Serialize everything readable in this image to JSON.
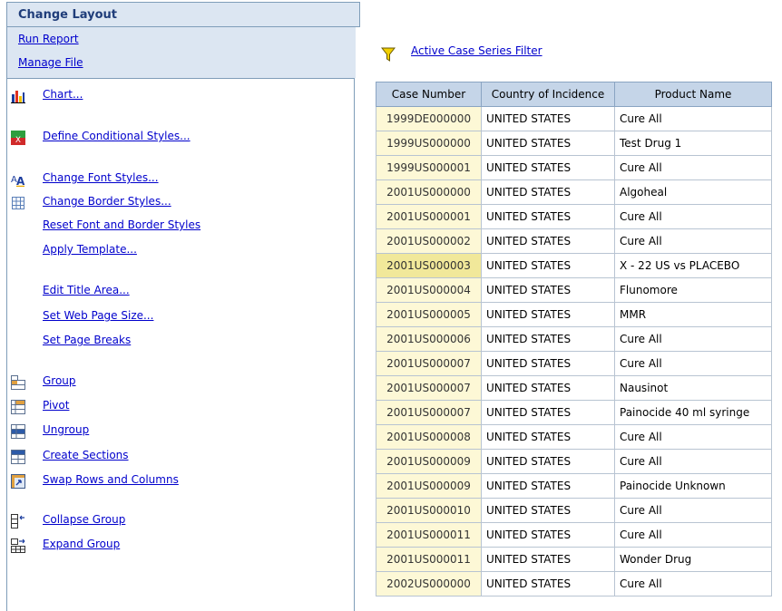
{
  "menu": {
    "header_title": "Change Layout",
    "run_report": "Run Report",
    "manage_file": "Manage File",
    "items": [
      {
        "label": "Chart...",
        "icon": "chart-icon"
      },
      {
        "label": "Define Conditional Styles...",
        "icon": "conditional-styles-icon"
      },
      {
        "label": "Change Font Styles...",
        "icon": "font-styles-icon"
      },
      {
        "label": "Change Border Styles...",
        "icon": "border-styles-icon"
      },
      {
        "label": "Reset Font and Border Styles",
        "icon": ""
      },
      {
        "label": "Apply Template...",
        "icon": ""
      },
      {
        "label": "Edit Title Area...",
        "icon": ""
      },
      {
        "label": "Set Web Page Size...",
        "icon": ""
      },
      {
        "label": "Set Page Breaks",
        "icon": ""
      },
      {
        "label": "Group",
        "icon": "group-icon"
      },
      {
        "label": "Pivot",
        "icon": "pivot-icon"
      },
      {
        "label": "Ungroup",
        "icon": "ungroup-icon"
      },
      {
        "label": "Create Sections",
        "icon": "sections-icon"
      },
      {
        "label": "Swap Rows and Columns",
        "icon": "swap-icon"
      },
      {
        "label": "Collapse Group",
        "icon": "collapse-icon"
      },
      {
        "label": "Expand Group",
        "icon": "expand-icon"
      }
    ]
  },
  "filter": {
    "label": "Active Case Series Filter",
    "icon": "filter-funnel-icon"
  },
  "table": {
    "headers": [
      "Case Number",
      "Country of Incidence",
      "Product Name"
    ],
    "rows": [
      [
        "1999DE000000",
        "UNITED STATES",
        "Cure All"
      ],
      [
        "1999US000000",
        "UNITED STATES",
        "Test Drug 1"
      ],
      [
        "1999US000001",
        "UNITED STATES",
        "Cure All"
      ],
      [
        "2001US000000",
        "UNITED STATES",
        "Algoheal"
      ],
      [
        "2001US000001",
        "UNITED STATES",
        "Cure All"
      ],
      [
        "2001US000002",
        "UNITED STATES",
        "Cure All"
      ],
      [
        "2001US000003",
        "UNITED STATES",
        "X - 22 US vs PLACEBO"
      ],
      [
        "2001US000004",
        "UNITED STATES",
        "Flunomore"
      ],
      [
        "2001US000005",
        "UNITED STATES",
        "MMR"
      ],
      [
        "2001US000006",
        "UNITED STATES",
        "Cure All"
      ],
      [
        "2001US000007",
        "UNITED STATES",
        "Cure All"
      ],
      [
        "2001US000007",
        "UNITED STATES",
        "Nausinot"
      ],
      [
        "2001US000007",
        "UNITED STATES",
        "Painocide  40 ml syringe"
      ],
      [
        "2001US000008",
        "UNITED STATES",
        "Cure All"
      ],
      [
        "2001US000009",
        "UNITED STATES",
        "Cure All"
      ],
      [
        "2001US000009",
        "UNITED STATES",
        "Painocide Unknown"
      ],
      [
        "2001US000010",
        "UNITED STATES",
        "Cure All"
      ],
      [
        "2001US000011",
        "UNITED STATES",
        "Cure All"
      ],
      [
        "2001US000011",
        "UNITED STATES",
        "Wonder Drug"
      ],
      [
        "2002US000000",
        "UNITED STATES",
        "Cure All"
      ]
    ],
    "highlighted_row": 6
  },
  "colors": {
    "panel_bg": "#dce6f2",
    "header_bg": "#c5d5e8",
    "case_cell_bg": "#fdf8d6",
    "link": "#0000cc"
  }
}
